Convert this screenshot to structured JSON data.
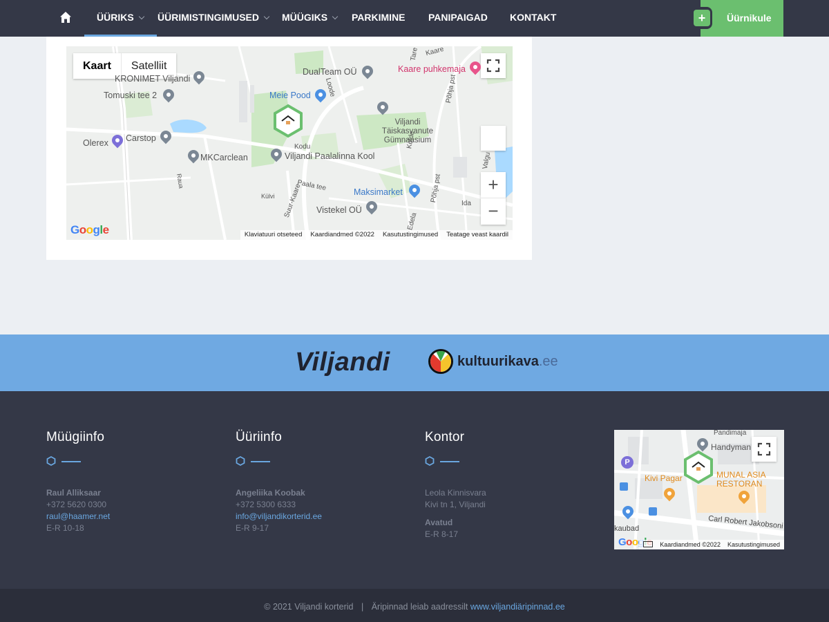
{
  "nav": {
    "items": [
      {
        "label": "ÜÜRIKS",
        "active": true
      },
      {
        "label": "ÜÜRIMISTINGIMUSED"
      },
      {
        "label": "MÜÜGIKS"
      },
      {
        "label": "PARKIMINE"
      },
      {
        "label": "PANIPAIGAD"
      },
      {
        "label": "KONTAKT"
      }
    ],
    "tenant_label": "Üürnikule",
    "plus_label": "+"
  },
  "map": {
    "type_map": "Kaart",
    "type_sat": "Satelliit",
    "pois": {
      "kaare": "Kaare puhkemaja",
      "dualteam": "DualTeam OÜ",
      "meie_pood": "Meie Pood",
      "kronimet": "KRONIMET Viljandi",
      "tomuski": "Tomuski tee 2",
      "olerex": "Olerex",
      "carstop": "Carstop",
      "mkcarclean": "MKCarclean",
      "paalalinna": "Viljandi Paalalinna Kool",
      "taiskasvanute": "Viljandi Täiskasvanute Gümnaasium",
      "maksimarket": "Maksimarket",
      "vistekel": "Vistekel OÜ"
    },
    "streets": {
      "kodu": "Kodu",
      "paala": "Paala tee",
      "suur_kaare": "Suur-Kaare",
      "kolde": "Kolde",
      "pohja": "Põhja pst",
      "ida": "Ida",
      "valgu": "Valgu",
      "edela": "Edela",
      "raua": "Raua",
      "kulvi": "Külvi",
      "loode": "Loode",
      "tare": "Tare",
      "kaare": "Kaare",
      "pohja_pst2": "Põhja pst"
    },
    "attribution": [
      "Klaviatuuri otseteed",
      "Kaardiandmed ©2022",
      "Kasutustingimused",
      "Teatage veast kaardil"
    ],
    "zoom_in": "+",
    "zoom_out": "−"
  },
  "partners": {
    "viljandi": "Viljandi",
    "kultuurikava_main": "kultuurikava",
    "kultuurikava_tld": ".ee"
  },
  "footer": {
    "sales": {
      "title": "Müügiinfo",
      "name": "Raul Alliksaar",
      "phone": "+372 5620 0300",
      "email": "raul@haamer.net",
      "hours": "E-R 10-18"
    },
    "rent": {
      "title": "Üüriinfo",
      "name": "Angeliika Koobak",
      "phone": "+372 5300 6333",
      "email": "info@viljandikorterid.ee",
      "hours": "E-R 9-17"
    },
    "office": {
      "title": "Kontor",
      "company": "Leola Kinnisvara",
      "address": "Kivi tn 1, Viljandi",
      "open_title": "Avatud",
      "hours": "E-R 8-17"
    },
    "mini_map": {
      "pandimaja": "Pandimaja",
      "handyman": "Handyman",
      "kivi_pagar": "Kivi Pagar",
      "munal": "MUNAL ASIA",
      "restoran": "RESTORAN",
      "carl": "Carl Robert Jakobsoni",
      "kaubad": "kaubad",
      "attribution": [
        "Kaardiandmed ©2022",
        "Kasutustingimused"
      ]
    }
  },
  "bottom": {
    "copyright": "© 2021 Viljandi korterid",
    "separator": "|",
    "text": "Äripinnad leiab aadressilt",
    "link": "www.viljandiäripinnad.ee"
  },
  "colors": {
    "nav_bg": "#343847",
    "accent_green": "#6bbf6f",
    "accent_blue": "#6fa9e2",
    "link_blue": "#6aa7e0",
    "footer_bg": "#343847"
  }
}
